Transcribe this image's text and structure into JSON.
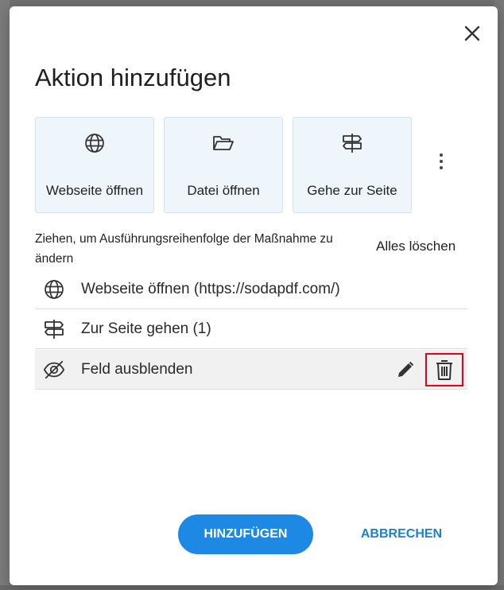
{
  "dialog": {
    "title": "Aktion hinzufügen",
    "close_icon": "close-icon"
  },
  "tiles": [
    {
      "label": "Webseite öffnen",
      "icon": "globe-icon"
    },
    {
      "label": "Datei öffnen",
      "icon": "folder-open-icon"
    },
    {
      "label": "Gehe zur Seite",
      "icon": "signpost-icon"
    }
  ],
  "more_icon": "more-vertical-icon",
  "hint": "Ziehen, um Ausführungsreihenfolge der Maßnahme zu ändern",
  "clear_all": "Alles löschen",
  "actions": [
    {
      "label": "Webseite öffnen (https://sodapdf.com/)",
      "icon": "globe-icon"
    },
    {
      "label": "Zur Seite gehen (1)",
      "icon": "signpost-icon"
    },
    {
      "label": "Feld ausblenden",
      "icon": "eye-off-icon",
      "selected": true
    }
  ],
  "row_controls": {
    "edit_icon": "pencil-icon",
    "delete_icon": "trash-icon"
  },
  "buttons": {
    "add": "HINZUFÜGEN",
    "cancel": "ABBRECHEN"
  },
  "colors": {
    "primary": "#1e88e5",
    "highlight": "#e2001a",
    "tile_bg": "#eef6fb"
  }
}
